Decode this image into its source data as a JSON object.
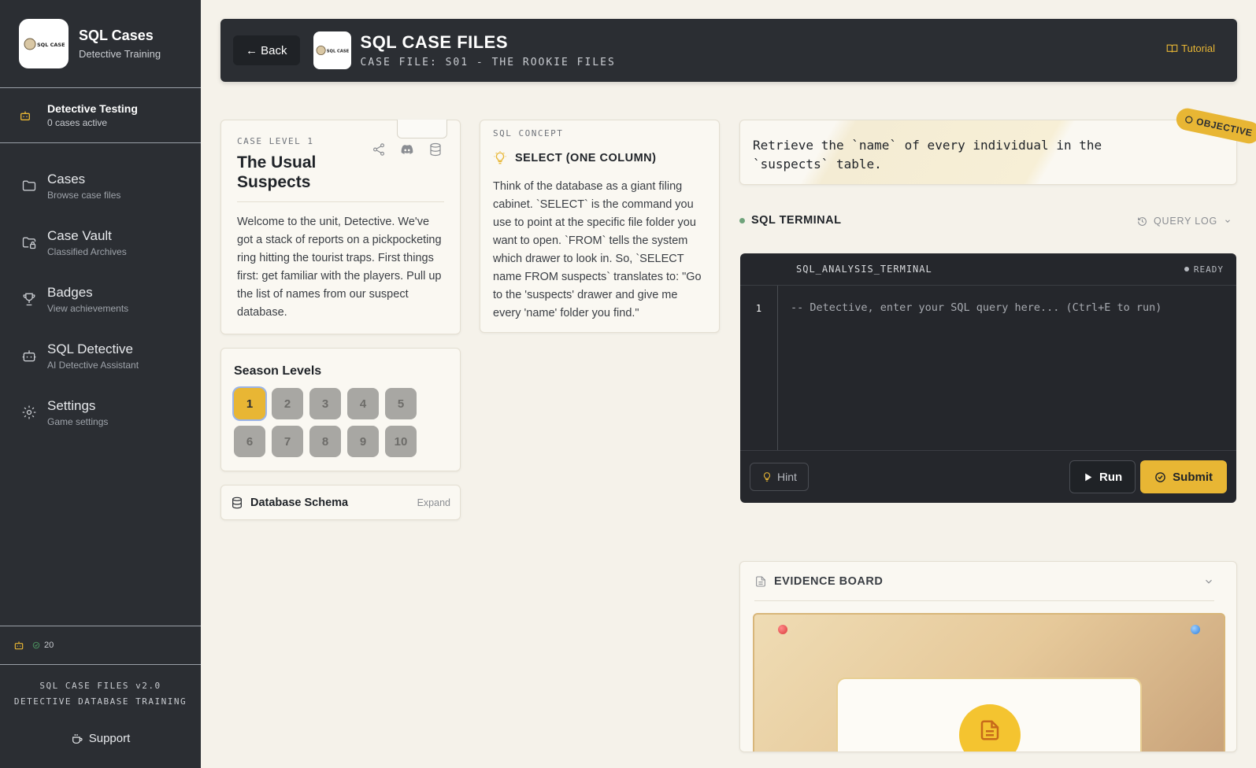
{
  "brand": {
    "title": "SQL Cases",
    "subtitle": "Detective Training",
    "logo_text": "SQL CASE FILES"
  },
  "user": {
    "name": "Detective Testing",
    "status": "0 cases active"
  },
  "nav": [
    {
      "label": "Cases",
      "sub": "Browse case files",
      "icon": "folder-icon"
    },
    {
      "label": "Case Vault",
      "sub": "Classified Archives",
      "icon": "folder-lock-icon"
    },
    {
      "label": "Badges",
      "sub": "View achievements",
      "icon": "trophy-icon"
    },
    {
      "label": "SQL Detective",
      "sub": "AI Detective Assistant",
      "icon": "bot-icon"
    },
    {
      "label": "Settings",
      "sub": "Game settings",
      "icon": "gear-icon"
    }
  ],
  "sidebar_stats": {
    "points": "20"
  },
  "footer": {
    "line1": "SQL CASE FILES v2.0",
    "line2": "DETECTIVE DATABASE TRAINING",
    "support": "Support"
  },
  "header": {
    "back": "← Back",
    "title": "SQL CASE FILES",
    "subtitle": "CASE FILE: S01 - THE ROOKIE FILES",
    "tutorial": "Tutorial"
  },
  "case": {
    "level": "CASE LEVEL 1",
    "title": "The Usual Suspects",
    "body": "Welcome to the unit, Detective. We've got a stack of reports on a pickpocketing ring hitting the tourist traps. First things first: get familiar with the players. Pull up the list of names from our suspect database."
  },
  "concept": {
    "eyebrow": "SQL CONCEPT",
    "title": "SELECT (ONE COLUMN)",
    "body": "Think of the database as a giant filing cabinet. `SELECT` is the command you use to point at the specific file folder you want to open. `FROM` tells the system which drawer to look in. So, `SELECT name FROM suspects` translates to: \"Go to the 'suspects' drawer and give me every 'name' folder you find.\""
  },
  "levels": {
    "title": "Season Levels",
    "items": [
      "1",
      "2",
      "3",
      "4",
      "5",
      "6",
      "7",
      "8",
      "9",
      "10"
    ],
    "active": "1"
  },
  "schema": {
    "label": "Database Schema",
    "expand": "Expand"
  },
  "objective": {
    "tag": "OBJECTIVE",
    "text": "Retrieve the `name` of every individual in the `suspects` table."
  },
  "terminal": {
    "label": "SQL TERMINAL",
    "query_log": "QUERY LOG",
    "title": "SQL_ANALYSIS_TERMINAL",
    "status": "READY",
    "line_number": "1",
    "placeholder": "-- Detective, enter your SQL query here... (Ctrl+E to run)",
    "hint": "Hint",
    "run": "Run",
    "submit": "Submit"
  },
  "evidence": {
    "label": "EVIDENCE BOARD"
  },
  "colors": {
    "accent": "#e8b634",
    "sidebar": "#2b2e33",
    "background": "#f5f2ea"
  }
}
